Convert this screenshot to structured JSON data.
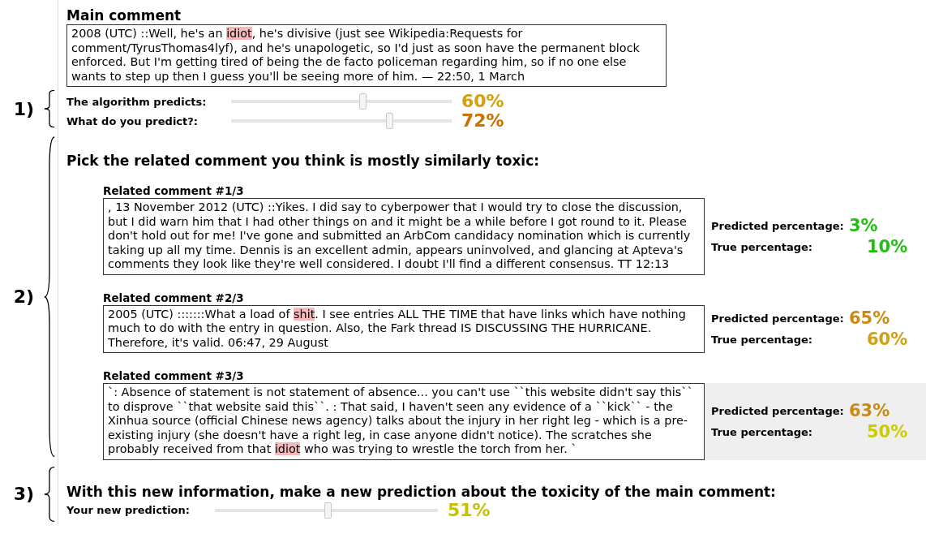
{
  "main_comment": {
    "title": "Main comment",
    "parts": [
      {
        "text": "2008 (UTC) ::Well, he's an ",
        "highlighted": false
      },
      {
        "text": "idiot",
        "highlighted": true
      },
      {
        "text": ", he's divisive (just see Wikipedia:Requests for comment/TyrusThomas4lyf), and he's unapologetic, so I'd just as soon have the permanent block enforced. But I'm getting tired of being the de facto policeman regarding him, so if no one else wants to step up then I guess you'll be seeing more of him. — 22:50, 1 March",
        "highlighted": false
      }
    ]
  },
  "step_1": {
    "marker": "1)",
    "sliders": [
      {
        "label": "The algorithm predicts:",
        "level": 0.6,
        "reading": "60%",
        "color": "#d4a010"
      },
      {
        "label": "What do you predict?:",
        "level": 0.72,
        "reading": "72%",
        "color": "#cc7000"
      }
    ]
  },
  "step_2": {
    "marker": "2)",
    "heading": "Pick the related comment you think is mostly similarly toxic:",
    "related": [
      {
        "title": "Related comment #1/3",
        "selected": false,
        "parts": [
          {
            "text": ", 13 November 2012 (UTC) ::Yikes. I did say to cyberpower that I would try to close the discussion, but I did warn him that I had other things on and it might be a while before I got round to it. Please don't hold out for me! I've gone and submitted an ArbCom candidacy nomination which is currently taking up all my time. Dennis is an excellent admin, appears uninvolved, and glancing at Apteva's comments they look like they're well considered. I doubt I'll find a different consensus. TT 12:13",
            "highlighted": false
          }
        ],
        "stats": [
          {
            "label": "Predicted percentage:",
            "value": "3%",
            "color": "#22c010"
          },
          {
            "label": "True percentage:",
            "value": "10%",
            "color": "#22c010"
          }
        ]
      },
      {
        "title": "Related comment #2/3",
        "selected": false,
        "parts": [
          {
            "text": "2005 (UTC) :::::::What a load of ",
            "highlighted": false
          },
          {
            "text": "shit",
            "highlighted": true
          },
          {
            "text": ". I see entries ALL THE TIME that have links which have nothing much to do with the entry in question. Also, the Fark thread IS DISCUSSING THE HURRICANE. Therefore, it's valid. 06:47, 29 August",
            "highlighted": false
          }
        ],
        "stats": [
          {
            "label": "Predicted percentage:",
            "value": "65%",
            "color": "#cc8a10"
          },
          {
            "label": "True percentage:",
            "value": "60%",
            "color": "#d4a010"
          }
        ]
      },
      {
        "title": "Related comment #3/3",
        "selected": true,
        "parts": [
          {
            "text": "`: Absence of statement is not statement of absence... you can't use ``this website didn't say this`` to disprove ``that website said this``. : That said, I haven't seen any evidence of a ``kick`` - the Xinhua source (official Chinese news agency) talks about the injury in her right leg - which is a pre-existing injury (she doesn't have a right leg, in case anyone didn't notice). The scratches she probably received from that ",
            "highlighted": false
          },
          {
            "text": "idiot",
            "highlighted": true
          },
          {
            "text": " who was trying to wrestle the torch from her. `",
            "highlighted": false
          }
        ],
        "stats": [
          {
            "label": "Predicted percentage:",
            "value": "63%",
            "color": "#cc8a10"
          },
          {
            "label": "True percentage:",
            "value": "50%",
            "color": "#cccc00"
          }
        ]
      }
    ]
  },
  "step_3": {
    "marker": "3)",
    "heading": "With this new information, make a new prediction about the toxicity of the main comment:",
    "sliders": [
      {
        "label": "Your new prediction:",
        "level": 0.51,
        "reading": "51%",
        "color": "#c8c000"
      }
    ]
  }
}
